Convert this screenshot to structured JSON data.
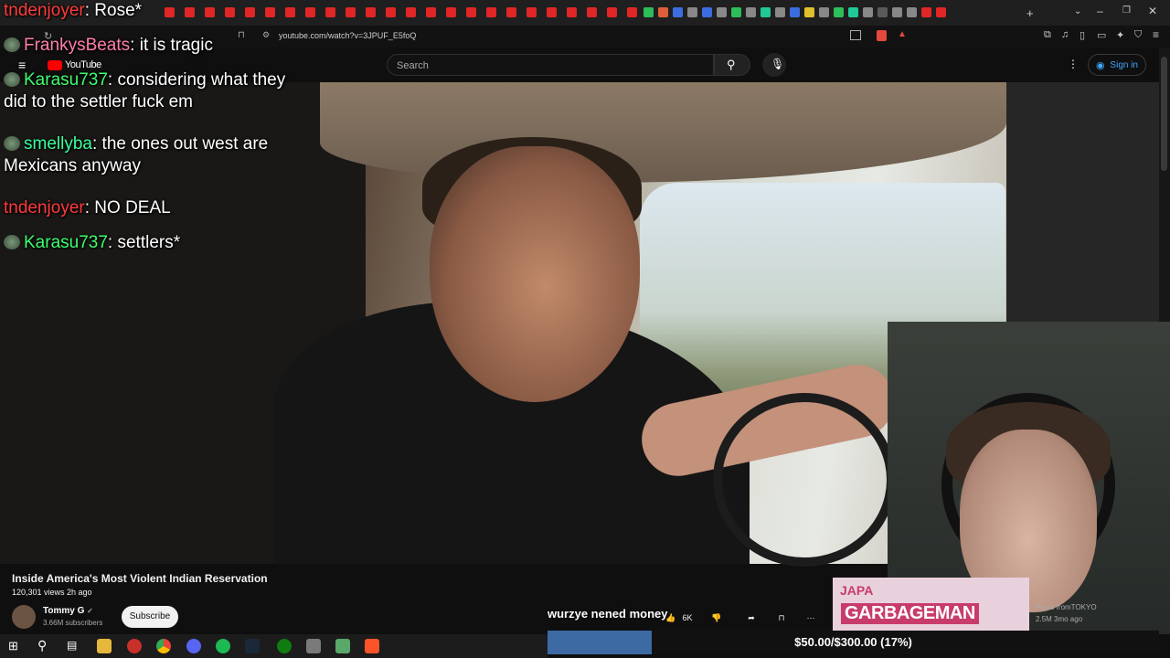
{
  "browser": {
    "url": "youtube.com/watch?v=3JPUF_E5foQ"
  },
  "youtube": {
    "logo_label": "YouTube",
    "search_placeholder": "Search",
    "signin_label": "Sign in"
  },
  "chat": [
    {
      "user": "tndenjoyer",
      "message": "Rose*",
      "color": "#ff3b3b"
    },
    {
      "user": "FrankysBeats",
      "message": "it is tragic",
      "color": "#ff7fa8"
    },
    {
      "user": "Karasu737",
      "message": "considering what they did to the settler fuck em",
      "color": "#3dff6e"
    },
    {
      "user": "smellyba",
      "message": "the ones out west are Mexicans anyway",
      "color": "#38ff9c"
    },
    {
      "user": "tndenjoyer",
      "message": "NO DEAL",
      "color": "#ff3b3b"
    },
    {
      "user": "Karasu737",
      "message": "settlers*",
      "color": "#3dff6e"
    }
  ],
  "video": {
    "title": "Inside America's Most Violent Indian Reservation",
    "views_age": "120,301 views  2h ago",
    "channel": "Tommy G",
    "subscribers": "3.66M subscribers",
    "subscribe_label": "Subscribe",
    "like_count": "6K"
  },
  "overlay": {
    "tts_message": "wurzye nened money",
    "goal_text": "$50.00/$300.00 (17%)",
    "goal_progress": 0.17
  },
  "recommended": {
    "thumb_text": "GARBAGEMAN",
    "thumb_top_text": "JAPA",
    "channel": "Paolo fromTOKYO",
    "views_age": "2.5M  3mo ago"
  },
  "colors": {
    "accent": "#3ea6ff",
    "goal_fill": "#3d6aa3"
  }
}
